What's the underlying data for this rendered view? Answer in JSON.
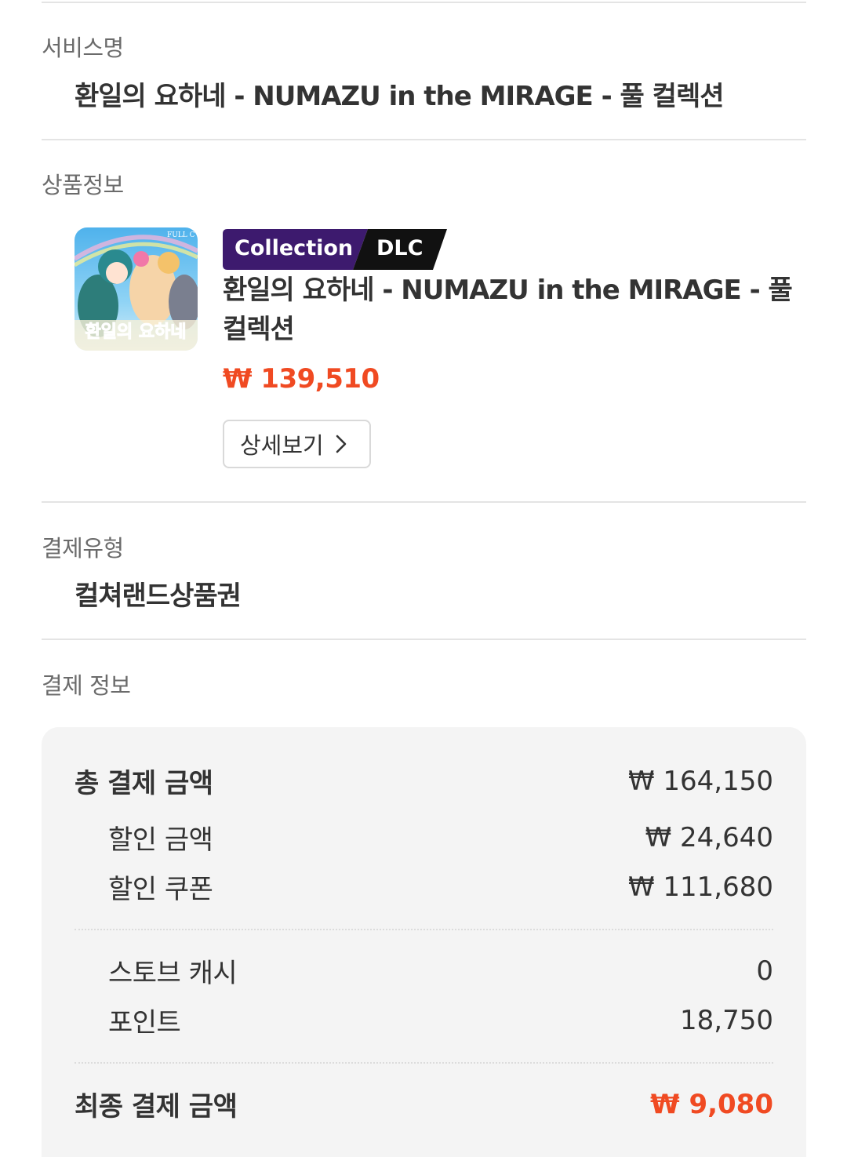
{
  "service": {
    "label": "서비스명",
    "value": "환일의 요하네 - NUMAZU in the MIRAGE - 풀 컬렉션"
  },
  "product": {
    "label": "상품정보",
    "badge_collection": "Collection",
    "badge_dlc": "DLC",
    "title": "환일의 요하네 - NUMAZU in the MIRAGE - 풀 컬렉션",
    "price": "₩ 139,510",
    "detail_button": "상세보기",
    "thumbnail_text": "환일의 요하네"
  },
  "payment_type": {
    "label": "결제유형",
    "value": "컬쳐랜드상품권"
  },
  "payment_info": {
    "label": "결제 정보",
    "total_label": "총 결제 금액",
    "total_value": "₩ 164,150",
    "discount_label": "할인 금액",
    "discount_value": "₩ 24,640",
    "coupon_label": "할인 쿠폰",
    "coupon_value": "₩ 111,680",
    "cash_label": "스토브 캐시",
    "cash_value": "0",
    "point_label": "포인트",
    "point_value": "18,750",
    "final_label": "최종 결제 금액",
    "final_value": "₩ 9,080"
  },
  "colors": {
    "accent": "#f04a22",
    "badge_purple": "#3d1a6e",
    "badge_black": "#111111"
  }
}
